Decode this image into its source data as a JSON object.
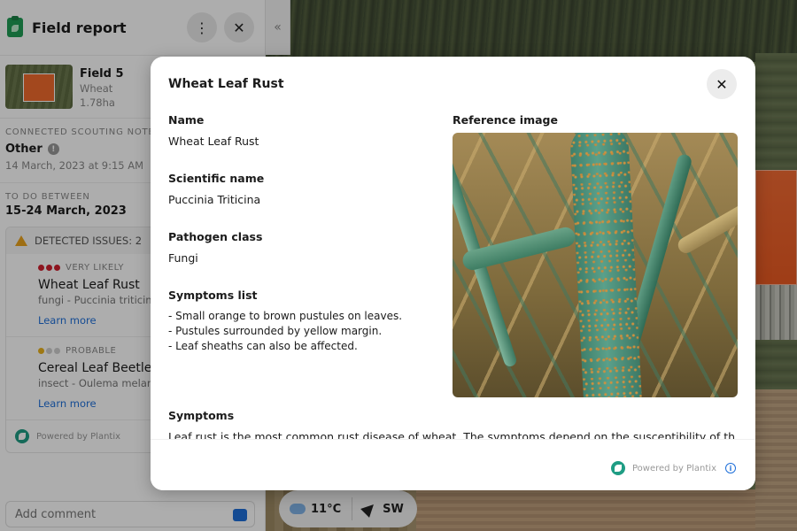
{
  "panel": {
    "title": "Field report",
    "more_icon": "⋮",
    "close_icon": "✕",
    "collapse_icon": "«",
    "field": {
      "name": "Field 5",
      "crop": "Wheat",
      "area": "1.78ha"
    },
    "scouting": {
      "label": "Connected scouting note",
      "title": "Other",
      "info": "!",
      "date": "14 March, 2023 at 9:15 AM"
    },
    "todo": {
      "label": "To do between",
      "dates": "15-24 March, 2023"
    },
    "issues": {
      "header": "Detected issues: 2",
      "items": [
        {
          "likelihood": "Very likely",
          "name": "Wheat Leaf Rust",
          "scientific": "fungi - Puccinia triticina",
          "link": "Learn more"
        },
        {
          "likelihood": "Probable",
          "name": "Cereal Leaf Beetle",
          "scientific": "insect - Oulema melanopus",
          "link": "Learn more"
        }
      ],
      "powered": "Powered by Plantix"
    },
    "comment_placeholder": "Add comment"
  },
  "weather": {
    "temp": "11°C",
    "wind": "SW"
  },
  "modal": {
    "title": "Wheat Leaf Rust",
    "close_icon": "✕",
    "name_label": "Name",
    "name_value": "Wheat Leaf Rust",
    "sci_label": "Scientific name",
    "sci_value": "Puccinia Triticina",
    "class_label": "Pathogen class",
    "class_value": "Fungi",
    "symptoms_list_label": "Symptoms list",
    "symptoms_list": [
      "- Small orange to brown pustules on leaves.",
      "- Pustules surrounded by yellow margin.",
      "- Leaf sheaths can also be affected."
    ],
    "ref_label": "Reference image",
    "symptoms_label": "Symptoms",
    "symptoms_text": "Leaf rust is the most common rust disease of wheat. The symptoms depend on the susceptibility of the",
    "powered": "Powered by Plantix",
    "info_icon": "i"
  },
  "colors": {
    "accent": "#1e6fd9",
    "field_orange": "#f06a2d",
    "plantix": "#1f9d84",
    "very_likely": "#d0202f",
    "probable": "#e9b21c"
  }
}
